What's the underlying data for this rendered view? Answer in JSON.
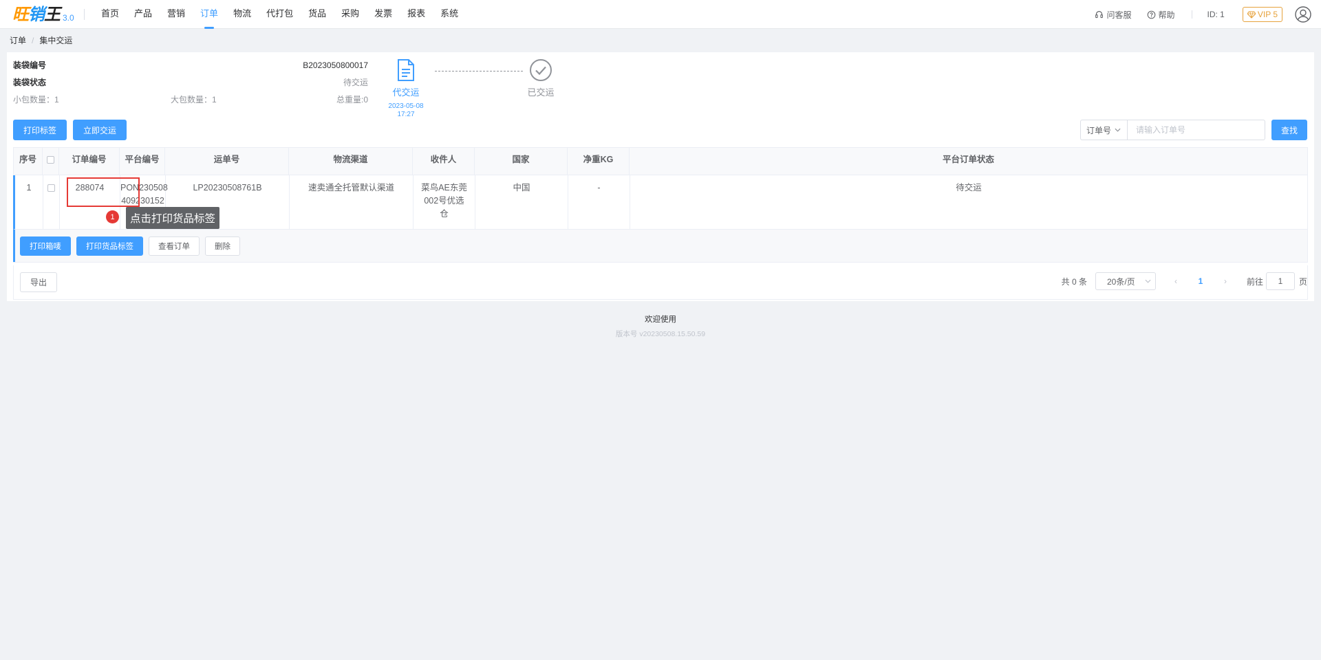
{
  "app": {
    "logo_text": "旺销王",
    "logo_version": "3.0"
  },
  "nav": {
    "items": [
      {
        "label": "首页",
        "active": false
      },
      {
        "label": "产品",
        "active": false
      },
      {
        "label": "营销",
        "active": false
      },
      {
        "label": "订单",
        "active": true
      },
      {
        "label": "物流",
        "active": false
      },
      {
        "label": "代打包",
        "active": false
      },
      {
        "label": "货品",
        "active": false
      },
      {
        "label": "采购",
        "active": false
      },
      {
        "label": "发票",
        "active": false
      },
      {
        "label": "报表",
        "active": false
      },
      {
        "label": "系统",
        "active": false
      }
    ]
  },
  "header_right": {
    "service_label": "问客服",
    "help_label": "帮助",
    "id_label": "ID: 1",
    "vip_label": "VIP 5"
  },
  "breadcrumb": {
    "root": "订单",
    "current": "集中交运"
  },
  "bag_info": {
    "bag_no_label": "装袋编号",
    "bag_no_value": "B2023050800017",
    "bag_status_label": "装袋状态",
    "bag_status_value": "待交运",
    "small_count": "小包数量：1",
    "big_count": "大包数量：1",
    "total_weight": "总重量:0"
  },
  "steps": {
    "step1_title": "代交运",
    "step1_date": "2023-05-08",
    "step1_time": "17:27",
    "step2_title": "已交运"
  },
  "actions": {
    "print_label": "打印标签",
    "ship_now": "立即交运"
  },
  "search": {
    "field_label": "订单号",
    "placeholder": "请输入订单号",
    "button": "查找"
  },
  "table": {
    "headers": [
      "序号",
      "",
      "订单编号",
      "平台编号",
      "运单号",
      "物流渠道",
      "收件人",
      "国家",
      "净重KG",
      "平台订单状态"
    ],
    "rows": [
      {
        "index": "1",
        "order_no": "288074",
        "platform_no_line1": "PON230508",
        "platform_no_line2": "409230152",
        "waybill_no": "LP20230508761B",
        "channel": "速卖通全托管默认渠道",
        "recipient_line1": "菜鸟AE东莞",
        "recipient_line2": "002号优选",
        "recipient_line3": "仓",
        "country": "中国",
        "net_weight": "-",
        "platform_status": "待交运"
      }
    ],
    "row_actions": {
      "print_mark": "打印箱唛",
      "print_goods_label": "打印货品标签",
      "view_order": "查看订单",
      "delete": "删除"
    }
  },
  "annotation": {
    "badge": "1",
    "tip": "点击打印货品标签"
  },
  "pager": {
    "export": "导出",
    "total": "共 0 条",
    "page_size": "20条/页",
    "current_page": "1",
    "goto_label": "前往",
    "goto_value": "1",
    "page_unit": "页"
  },
  "footer": {
    "welcome": "欢迎使用",
    "version": "版本号 v20230508.15.50.59"
  },
  "colors": {
    "primary": "#409eff",
    "highlight": "#e53935",
    "vip": "#e6a23c"
  }
}
